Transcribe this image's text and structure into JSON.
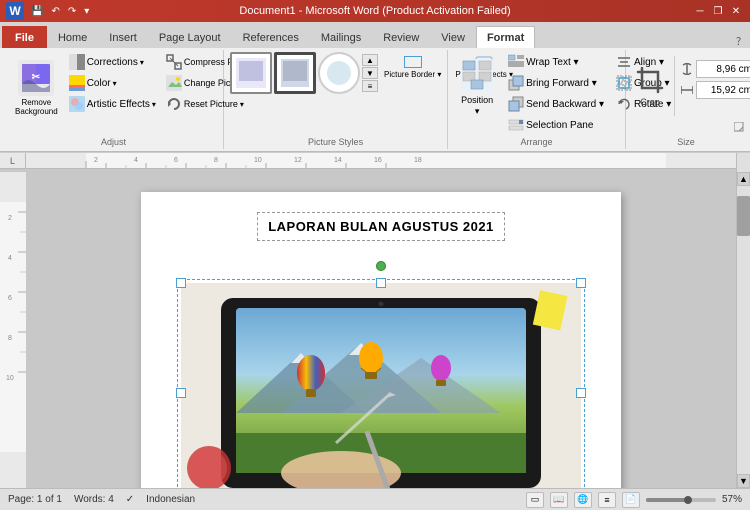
{
  "titlebar": {
    "title": "Document1 - Microsoft Word (Product Activation Failed)",
    "word_icon": "W",
    "quick_access": [
      "save",
      "undo",
      "redo",
      "customize"
    ],
    "controls": [
      "minimize",
      "restore",
      "close"
    ]
  },
  "tabs": [
    {
      "id": "file",
      "label": "File"
    },
    {
      "id": "home",
      "label": "Home"
    },
    {
      "id": "insert",
      "label": "Insert"
    },
    {
      "id": "page-layout",
      "label": "Page Layout"
    },
    {
      "id": "references",
      "label": "References"
    },
    {
      "id": "mailings",
      "label": "Mailings"
    },
    {
      "id": "review",
      "label": "Review"
    },
    {
      "id": "view",
      "label": "View"
    },
    {
      "id": "format",
      "label": "Format",
      "active": true
    }
  ],
  "ribbon": {
    "groups": {
      "adjust": {
        "label": "Adjust",
        "remove_bg": "Remove\nBackground",
        "corrections": "Corrections",
        "color": "Color",
        "artistic": "Artistic Effects",
        "compress": "Compress\nPictures",
        "change": "Change\nPicture",
        "reset": "Reset\nPicture"
      },
      "picture_styles": {
        "label": "Picture Styles"
      },
      "arrange": {
        "label": "Arrange",
        "position": "Position",
        "wrap_text": "Wrap\nText",
        "bring_forward": "Bring Forward",
        "send_backward": "Send Backward",
        "selection_pane": "Selection Pane",
        "align": "Align",
        "group": "Group",
        "rotate": "Rotate"
      },
      "size": {
        "label": "Size",
        "height_label": "8,96 cm",
        "width_label": "15,92 cm",
        "crop": "Crop"
      }
    }
  },
  "document": {
    "title": "LAPORAN BULAN AGUSTUS 2021"
  },
  "statusbar": {
    "page": "Page: 1 of 1",
    "words": "Words: 4",
    "language": "Indonesian",
    "zoom": "57%"
  }
}
